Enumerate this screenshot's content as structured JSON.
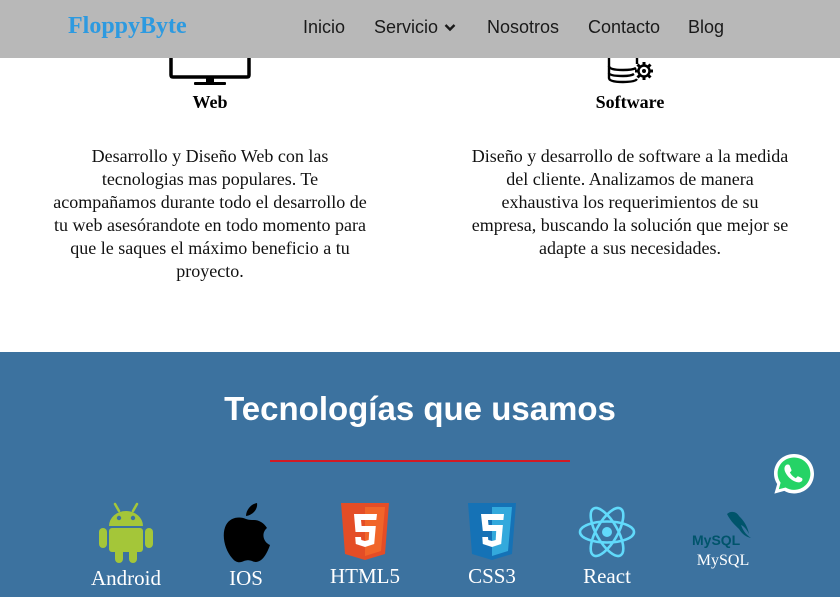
{
  "navbar": {
    "brand": "FloppyByte",
    "items": [
      {
        "label": "Inicio"
      },
      {
        "label": "Servicio"
      },
      {
        "label": "Nosotros"
      },
      {
        "label": "Contacto"
      },
      {
        "label": "Blog"
      }
    ]
  },
  "services": [
    {
      "title": "Web",
      "icon": "monitor-icon",
      "lines": [
        "Desarrollo y Diseño Web con las",
        "tecnologias mas populares. Te",
        "acompañamos durante todo el desarrollo de",
        "tu web asesórandote en todo momento para",
        "que le saques el máximo beneficio a tu",
        "proyecto."
      ]
    },
    {
      "title": "Software",
      "icon": "database-gear-icon",
      "lines": [
        "Diseño y desarrollo de software a la medida",
        "del cliente. Analizamos de manera",
        "exhaustiva los requerimientos de su",
        "empresa, buscando la solución que mejor se",
        "adapte a sus necesidades."
      ]
    }
  ],
  "technologies": {
    "title": "Tecnologías que usamos",
    "accent_color": "#d11a24",
    "background_color": "#3c729f",
    "items": [
      {
        "label": "Android",
        "icon": "android-icon",
        "color": "#a4c639"
      },
      {
        "label": "IOS",
        "icon": "apple-icon",
        "color": "#000000"
      },
      {
        "label": "HTML5",
        "icon": "html5-icon",
        "color": "#e44d26"
      },
      {
        "label": "CSS3",
        "icon": "css3-icon",
        "color": "#1572b6"
      },
      {
        "label": "React",
        "icon": "react-icon",
        "color": "#61dafb"
      },
      {
        "label": "MySQL",
        "icon": "mysql-icon",
        "color": "#00546b"
      }
    ]
  },
  "floating": {
    "icon": "whatsapp-icon",
    "color": "#25d366"
  }
}
